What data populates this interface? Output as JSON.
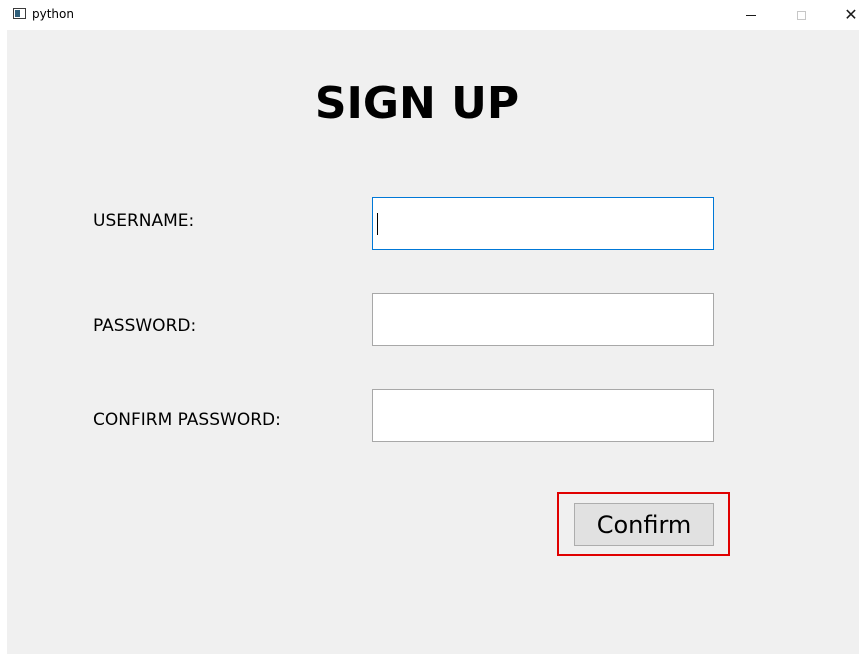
{
  "window": {
    "title": "python",
    "close_glyph": "✕"
  },
  "form": {
    "heading": "SIGN UP",
    "username_label": "USERNAME:",
    "password_label": "PASSWORD:",
    "confirm_password_label": "CONFIRM PASSWORD:",
    "username_value": "",
    "password_value": "",
    "confirm_password_value": "",
    "confirm_button_label": "Confirm"
  },
  "colors": {
    "focus_border": "#0078d7",
    "highlight_border": "#e00000",
    "client_background": "#f0f0f0"
  },
  "icons": {
    "app": "python-window-icon",
    "minimize": "minimize-icon",
    "maximize": "maximize-icon",
    "close": "close-icon"
  }
}
